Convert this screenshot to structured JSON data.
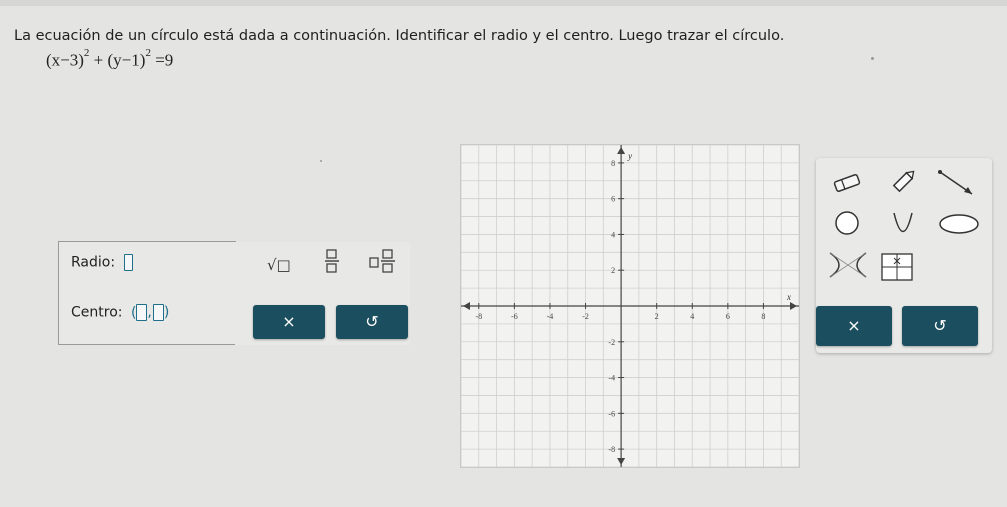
{
  "problem": {
    "prompt": "La ecuación de un círculo está dada a continuación. Identificar el radio y el centro. Luego trazar el círculo.",
    "equation": {
      "term1": "(x−3)",
      "exp1": "2",
      "plus": "+",
      "term2": "(y−1)",
      "exp2": "2",
      "rhs": "=9"
    }
  },
  "answers": {
    "radius_label": "Radio:",
    "center_label": "Centro:",
    "center_open": "(",
    "center_comma": ",",
    "center_close": ")"
  },
  "keypad": {
    "sqrt_label": "√□",
    "fraction_label": "□/□",
    "mixed_label": "□□/□",
    "clear_label": "×",
    "undo_label": "↺"
  },
  "graph": {
    "x_axis_label": "x",
    "y_axis_label": "y",
    "x_ticks": [
      "-8",
      "-6",
      "-4",
      "-2",
      "2",
      "4",
      "6",
      "8"
    ],
    "y_ticks": [
      "8",
      "6",
      "4",
      "2",
      "-2",
      "-4",
      "-6",
      "-8"
    ],
    "x_range": [
      -9,
      10
    ],
    "y_range": [
      -9,
      9
    ]
  },
  "tools": {
    "clear_label": "×",
    "undo_label": "↺",
    "items": [
      "eraser-icon",
      "pencil-icon",
      "ray-icon",
      "circle-icon",
      "parabola-icon",
      "ellipse-icon",
      "hyperbola-icon",
      "table-icon"
    ]
  },
  "colors": {
    "accent": "#1b4e5f",
    "slot_border": "#1f6f8b"
  }
}
